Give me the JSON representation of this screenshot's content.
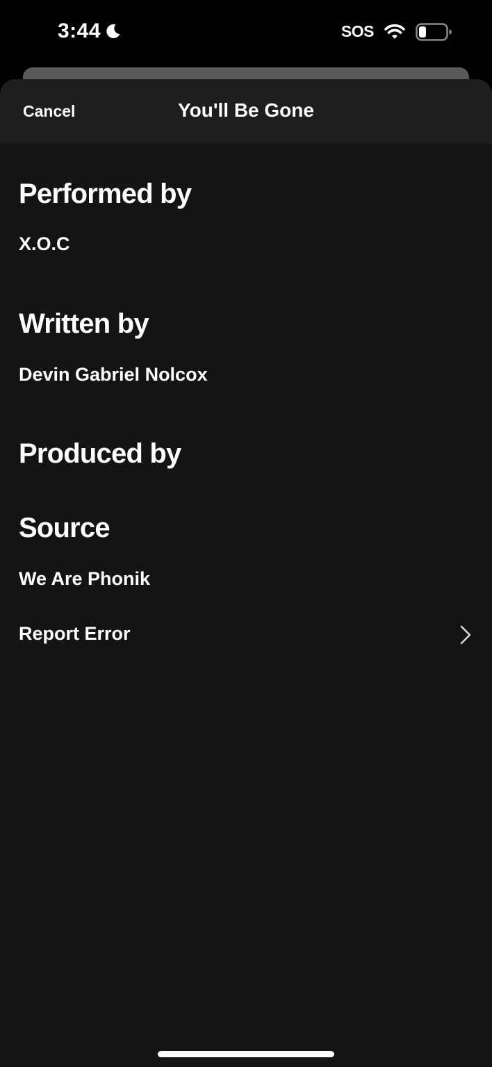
{
  "status_bar": {
    "time": "3:44",
    "sos": "SOS",
    "icons": [
      "moon-icon",
      "wifi-icon",
      "battery-icon"
    ]
  },
  "sheet": {
    "cancel_label": "Cancel",
    "title": "You'll Be Gone"
  },
  "credits": {
    "performed_by": {
      "heading": "Performed by",
      "value": "X.O.C"
    },
    "written_by": {
      "heading": "Written by",
      "value": "Devin Gabriel Nolcox"
    },
    "produced_by": {
      "heading": "Produced by"
    },
    "source": {
      "heading": "Source",
      "value": "We Are Phonik"
    }
  },
  "report_error": {
    "label": "Report Error",
    "icon": "chevron-right-icon"
  },
  "colors": {
    "background": "#000000",
    "sheet": "#141414",
    "header": "#1e1e1e",
    "text": "#ffffff",
    "back_card": "#5c5959"
  }
}
